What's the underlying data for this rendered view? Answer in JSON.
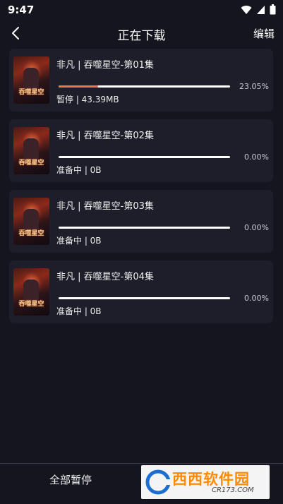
{
  "status_bar": {
    "time": "9:47",
    "icons": [
      "wifi-icon",
      "signal-icon",
      "battery-icon"
    ]
  },
  "header": {
    "title": "正在下载",
    "edit_label": "编辑",
    "back_icon": "chevron-left-icon"
  },
  "downloads": [
    {
      "title": "非凡 | 吞噬星空-第01集",
      "progress_percent": 23.05,
      "percent_label": "23.05%",
      "status": "暂停 | 43.39MB",
      "poster_text": "吞噬星空"
    },
    {
      "title": "非凡 | 吞噬星空-第02集",
      "progress_percent": 0,
      "percent_label": "0.00%",
      "status": "准备中 | 0B",
      "poster_text": "吞噬星空"
    },
    {
      "title": "非凡 | 吞噬星空-第03集",
      "progress_percent": 0,
      "percent_label": "0.00%",
      "status": "准备中 | 0B",
      "poster_text": "吞噬星空"
    },
    {
      "title": "非凡 | 吞噬星空-第04集",
      "progress_percent": 0,
      "percent_label": "0.00%",
      "status": "准备中 | 0B",
      "poster_text": "吞噬星空"
    }
  ],
  "footer": {
    "pause_all_label": "全部暂停",
    "watermark": {
      "brand": "西西软件园",
      "url": "CR173.COM"
    }
  },
  "colors": {
    "background": "#15151f",
    "card": "#1e1e2a",
    "progress_fill": "#e8774f",
    "progress_track": "#ffffff"
  }
}
